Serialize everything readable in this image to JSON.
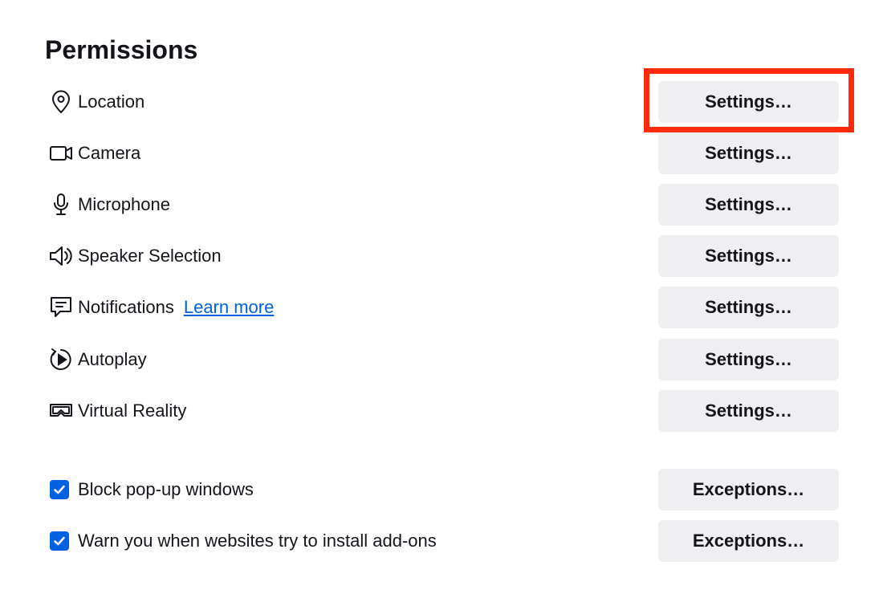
{
  "section": {
    "title": "Permissions"
  },
  "permissions": [
    {
      "label": "Location",
      "icon": "location-pin-icon",
      "button": "Settings…"
    },
    {
      "label": "Camera",
      "icon": "camera-icon",
      "button": "Settings…"
    },
    {
      "label": "Microphone",
      "icon": "microphone-icon",
      "button": "Settings…"
    },
    {
      "label": "Speaker Selection",
      "icon": "speaker-icon",
      "button": "Settings…"
    },
    {
      "label": "Notifications",
      "icon": "notification-icon",
      "link": "Learn more",
      "button": "Settings…"
    },
    {
      "label": "Autoplay",
      "icon": "autoplay-icon",
      "button": "Settings…"
    },
    {
      "label": "Virtual Reality",
      "icon": "vr-headset-icon",
      "button": "Settings…"
    }
  ],
  "options": [
    {
      "label": "Block pop-up windows",
      "checked": true,
      "button": "Exceptions…"
    },
    {
      "label": "Warn you when websites try to install add-ons",
      "checked": true,
      "button": "Exceptions…"
    }
  ],
  "colors": {
    "accent": "#0061e0",
    "highlight": "#ff2a0c",
    "button_bg": "#efeff2"
  }
}
